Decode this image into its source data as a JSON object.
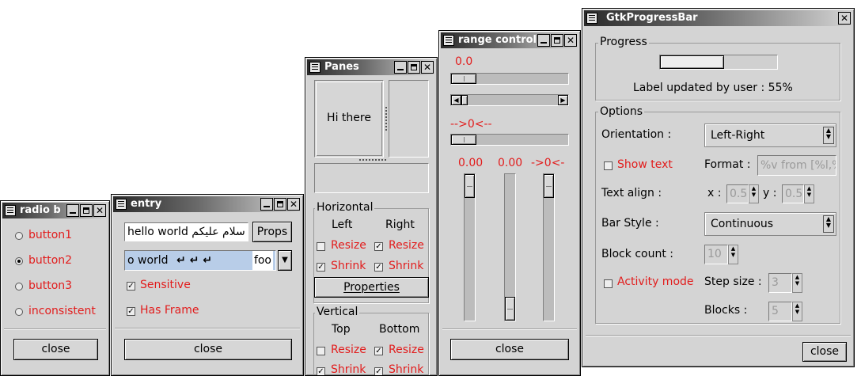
{
  "radio_window": {
    "title": "radio b",
    "options": [
      {
        "label": "button1",
        "selected": false
      },
      {
        "label": "button2",
        "selected": true
      },
      {
        "label": "button3",
        "selected": false
      },
      {
        "label": "inconsistent",
        "selected": false
      }
    ],
    "close_label": "close"
  },
  "entry_window": {
    "title": "entry",
    "entry_value": "hello world سلام عليكم",
    "props_label": "Props",
    "combo_value": "o world",
    "combo_tail": "foo",
    "sensitive_label": "Sensitive",
    "sensitive_checked": true,
    "has_frame_label": "Has Frame",
    "has_frame_checked": true,
    "close_label": "close"
  },
  "panes_window": {
    "title": "Panes",
    "pane_text": "Hi there",
    "horizontal": {
      "label": "Horizontal",
      "left": "Left",
      "right": "Right",
      "resize": "Resize",
      "shrink": "Shrink",
      "left_resize": false,
      "right_resize": true,
      "left_shrink": true,
      "right_shrink": true
    },
    "properties_label": "Properties",
    "vertical": {
      "label": "Vertical",
      "top": "Top",
      "bottom": "Bottom",
      "resize": "Resize",
      "shrink": "Shrink",
      "top_resize": false,
      "bottom_resize": true,
      "top_shrink": true,
      "bottom_shrink": true
    }
  },
  "range_window": {
    "title": "range control",
    "value1": "0.0",
    "value2": "-->0<--",
    "vvalue1": "0.00",
    "vvalue2": "0.00",
    "vvalue3": "->0<-",
    "close_label": "close"
  },
  "progress_window": {
    "title": "GtkProgressBar",
    "progress_frame_label": "Progress",
    "progress_fraction": 0.55,
    "progress_text": "Label updated by user : 55%",
    "options_frame_label": "Options",
    "orientation_label": "Orientation :",
    "orientation_value": "Left-Right",
    "show_text_label": "Show text",
    "show_text_checked": false,
    "format_label": "Format :",
    "format_value": "%v from [%l,%",
    "text_align_label": "Text align :",
    "x_label": "x :",
    "x_value": "0.5",
    "y_label": "y :",
    "y_value": "0.5",
    "bar_style_label": "Bar Style :",
    "bar_style_value": "Continuous",
    "block_count_label": "Block count :",
    "block_count_value": "10",
    "activity_mode_label": "Activity mode",
    "activity_mode_checked": false,
    "step_size_label": "Step size :",
    "step_size_value": "3",
    "blocks_label": "Blocks :",
    "blocks_value": "5",
    "close_label": "close"
  }
}
